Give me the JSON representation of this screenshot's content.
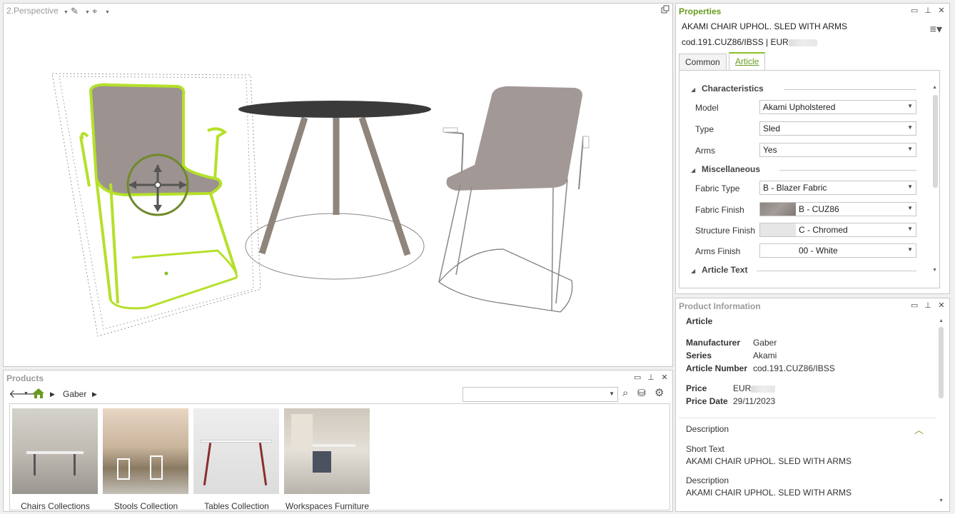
{
  "viewport": {
    "title": "2.Perspective",
    "tools": [
      "pen-icon",
      "target-icon"
    ]
  },
  "properties": {
    "title": "Properties",
    "product_name": "AKAMI CHAIR UPHOL. SLED WITH ARMS",
    "code": "cod.191.CUZ86/IBSS | EUR",
    "tabs": [
      "Common",
      "Article"
    ],
    "active_tab": "Article",
    "sections": {
      "characteristics": "Characteristics",
      "miscellaneous": "Miscellaneous",
      "article_text": "Article Text"
    },
    "fields": {
      "model": {
        "label": "Model",
        "value": "Akami Upholstered"
      },
      "type": {
        "label": "Type",
        "value": "Sled"
      },
      "arms": {
        "label": "Arms",
        "value": "Yes"
      },
      "fabric_type": {
        "label": "Fabric Type",
        "value": "B - Blazer Fabric"
      },
      "fabric_finish": {
        "label": "Fabric Finish",
        "value": "B - CUZ86"
      },
      "structure_finish": {
        "label": "Structure Finish",
        "value": "C - Chromed"
      },
      "arms_finish": {
        "label": "Arms Finish",
        "value": "00 - White"
      }
    },
    "colors": {
      "accent": "#8cbf26",
      "fabric_swatch": "#8b8480",
      "chrome_swatch": "#e6e6e6"
    }
  },
  "product_info": {
    "title": "Product Information",
    "article_heading": "Article",
    "manufacturer_label": "Manufacturer",
    "manufacturer": "Gaber",
    "series_label": "Series",
    "series": "Akami",
    "article_number_label": "Article Number",
    "article_number": "cod.191.CUZ86/IBSS",
    "price_label": "Price",
    "price": "EUR",
    "price_date_label": "Price Date",
    "price_date": "29/11/2023",
    "description_heading": "Description",
    "short_text_label": "Short Text",
    "short_text": "AKAMI CHAIR UPHOL. SLED WITH ARMS",
    "description_label": "Description",
    "description": "AKAMI CHAIR UPHOL. SLED WITH ARMS"
  },
  "products": {
    "title": "Products",
    "breadcrumb": "Gaber",
    "search_value": "",
    "items": [
      {
        "label": "Chairs Collections"
      },
      {
        "label": "Stools Collection"
      },
      {
        "label": "Tables Collection"
      },
      {
        "label": "Workspaces Furniture"
      }
    ]
  }
}
